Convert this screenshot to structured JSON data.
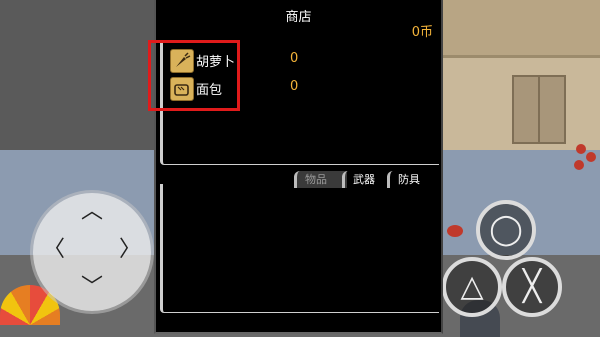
{
  "shop": {
    "title": "商店",
    "coins": "0币",
    "items": [
      {
        "name": "胡萝卜",
        "qty": "0",
        "icon": "carrot-icon"
      },
      {
        "name": "面包",
        "qty": "0",
        "icon": "bread-icon"
      }
    ],
    "tabs": [
      {
        "label": "物品",
        "active": true
      },
      {
        "label": "武器",
        "active": false
      },
      {
        "label": "防具",
        "active": false
      }
    ]
  },
  "controls": {
    "triangle": "△",
    "cross": "╳"
  },
  "colors": {
    "coin": "#f4b43a",
    "highlight": "#e01b1b",
    "panel": "#000000"
  }
}
